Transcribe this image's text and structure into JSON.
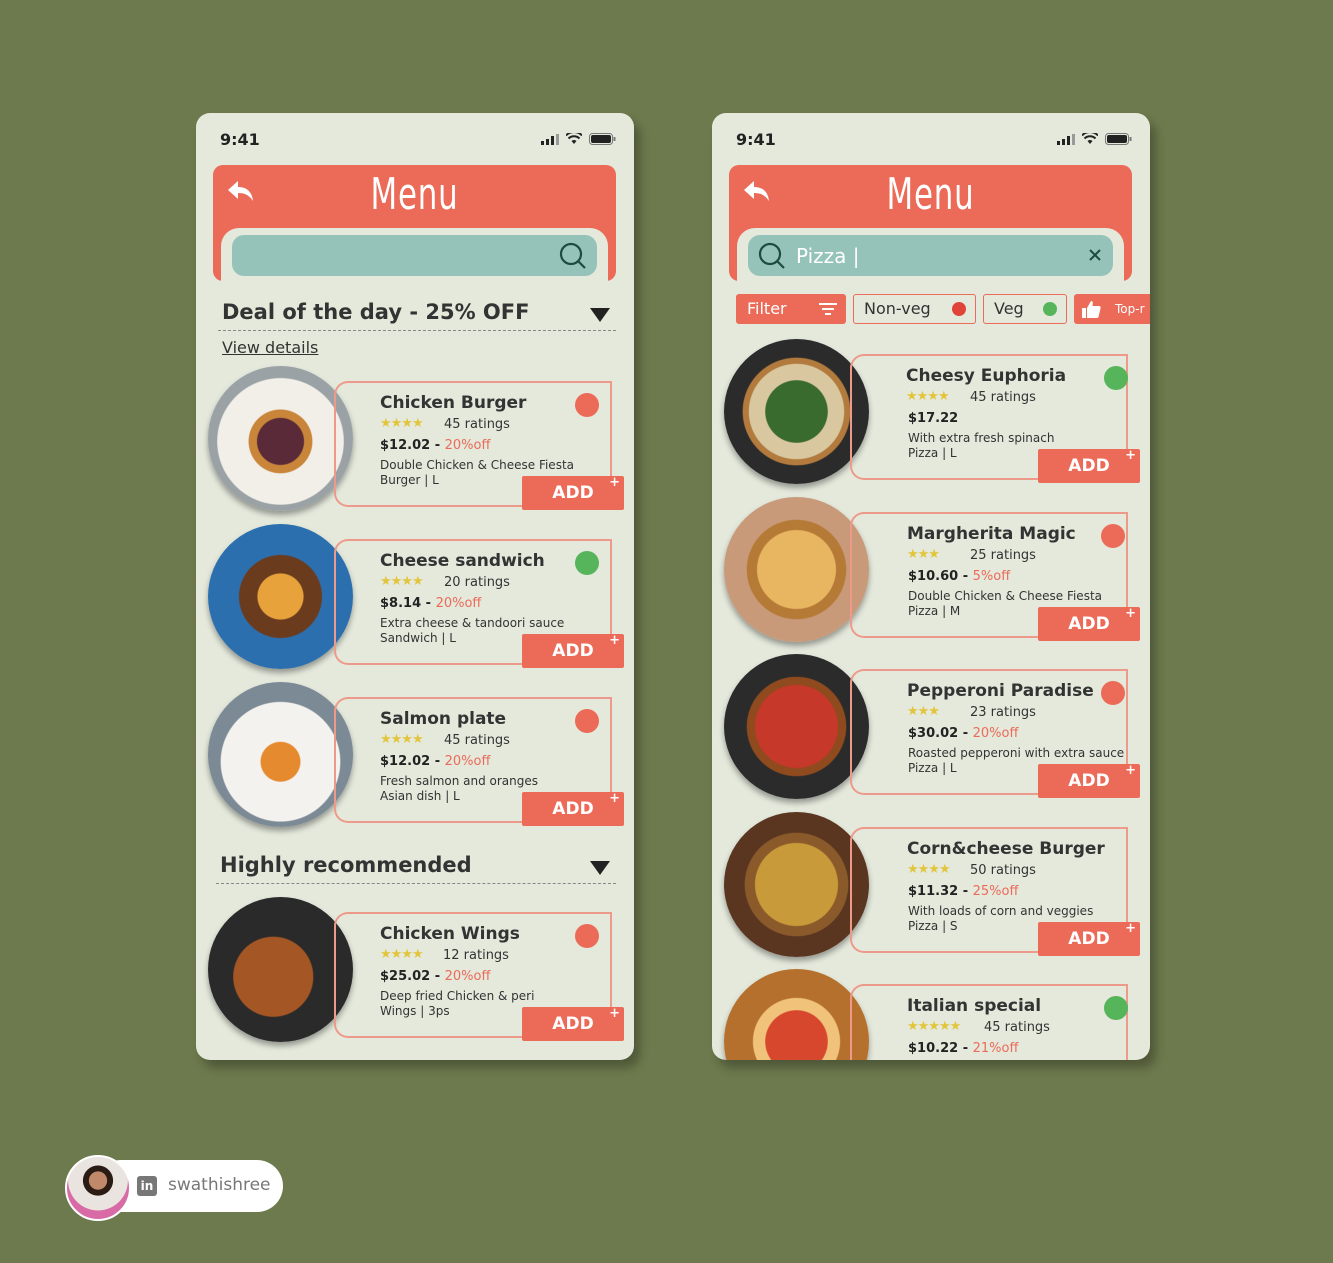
{
  "status": {
    "time": "9:41"
  },
  "screen1": {
    "title": "Menu",
    "search_value": "",
    "deal_title": "Deal of the day - 25% OFF",
    "view_details": "View details",
    "recommended_title": "Highly recommended",
    "items": [
      {
        "name": "Chicken Burger",
        "stars": "★★★★",
        "ratings": "45 ratings",
        "price": "$12.02",
        "off": "20%off",
        "desc1": "Double Chicken & Cheese Fiesta",
        "desc2": "Burger | L",
        "add": "ADD",
        "veg": false
      },
      {
        "name": "Cheese sandwich",
        "stars": "★★★★",
        "ratings": "20 ratings",
        "price": "$8.14",
        "off": "20%off",
        "desc1": "Extra cheese & tandoori sauce",
        "desc2": "Sandwich | L",
        "add": "ADD",
        "veg": true
      },
      {
        "name": "Salmon plate",
        "stars": "★★★★",
        "ratings": "45 ratings",
        "price": "$12.02",
        "off": "20%off",
        "desc1": "Fresh salmon and oranges",
        "desc2": "Asian dish | L",
        "add": "ADD",
        "veg": false
      },
      {
        "name": "Chicken Wings",
        "stars": "★★★★",
        "ratings": "12 ratings",
        "price": "$25.02",
        "off": "20%off",
        "desc1": "Deep fried Chicken & peri",
        "desc2": "Wings | 3ps",
        "add": "ADD",
        "veg": false
      }
    ]
  },
  "screen2": {
    "title": "Menu",
    "search_value": "Pizza |",
    "filters": {
      "filter": "Filter",
      "nonveg": "Non-veg",
      "veg": "Veg",
      "top": "Top-r"
    },
    "items": [
      {
        "name": "Cheesy Euphoria",
        "stars": "★★★★",
        "ratings": "45 ratings",
        "price": "$17.22",
        "off": "",
        "desc1": "With extra fresh spinach",
        "desc2": "Pizza | L",
        "add": "ADD",
        "veg": true
      },
      {
        "name": "Margherita Magic",
        "stars": "★★★",
        "ratings": "25 ratings",
        "price": "$10.60",
        "off": "5%off",
        "desc1": "Double Chicken & Cheese Fiesta",
        "desc2": "Pizza | M",
        "add": "ADD",
        "veg": false
      },
      {
        "name": "Pepperoni Paradise",
        "stars": "★★★",
        "ratings": "23 ratings",
        "price": "$30.02",
        "off": "20%off",
        "desc1": "Roasted pepperoni with extra sauce",
        "desc2": "Pizza | L",
        "add": "ADD",
        "veg": false
      },
      {
        "name": "Corn&cheese Burger",
        "stars": "★★★★",
        "ratings": "50 ratings",
        "price": "$11.32",
        "off": "25%off",
        "desc1": "With loads of corn and veggies",
        "desc2": "Pizza | S",
        "add": "ADD",
        "veg": false
      },
      {
        "name": "Italian special",
        "stars": "★★★★★",
        "ratings": "45 ratings",
        "price": "$10.22",
        "off": "21%off",
        "desc1": "",
        "desc2": "",
        "add": "ADD",
        "veg": true
      }
    ]
  },
  "profile": {
    "handle": "swathishree",
    "network": "in"
  },
  "colors": {
    "background": "#6d7a4d",
    "accent": "#ec6a58",
    "search": "#95c2b9",
    "screen": "#e4e9dc",
    "veg": "#56b45a",
    "star": "#e3c53b"
  }
}
